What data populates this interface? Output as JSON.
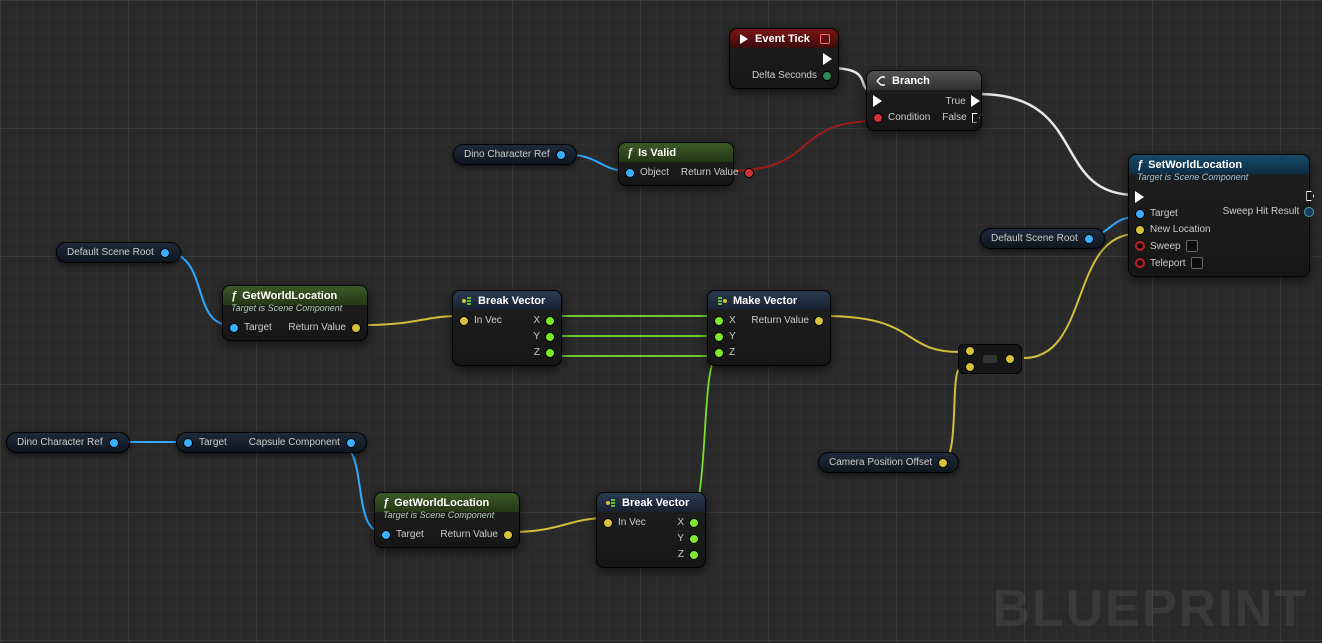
{
  "watermark": "BLUEPRINT",
  "nodes": {
    "event_tick": {
      "title": "Event Tick",
      "delta": "Delta Seconds"
    },
    "branch": {
      "title": "Branch",
      "cond": "Condition",
      "true": "True",
      "false": "False"
    },
    "is_valid": {
      "title": "Is Valid",
      "object": "Object",
      "ret": "Return Value"
    },
    "get_world_loc": {
      "title": "GetWorldLocation",
      "sub": "Target is Scene Component",
      "target": "Target",
      "ret": "Return Value"
    },
    "break_vector": {
      "title": "Break Vector",
      "invec": "In Vec",
      "x": "X",
      "y": "Y",
      "z": "Z"
    },
    "make_vector": {
      "title": "Make Vector",
      "x": "X",
      "y": "Y",
      "z": "Z",
      "ret": "Return Value"
    },
    "set_world_loc": {
      "title": "SetWorldLocation",
      "sub": "Target is Scene Component",
      "target": "Target",
      "newloc": "New Location",
      "sweep": "Sweep",
      "teleport": "Teleport",
      "hit": "Sweep Hit Result"
    }
  },
  "vars": {
    "dino_ref": "Dino Character Ref",
    "default_root": "Default Scene Root",
    "capsule": {
      "target": "Target",
      "label": "Capsule Component"
    },
    "cam_offset": "Camera Position Offset"
  }
}
